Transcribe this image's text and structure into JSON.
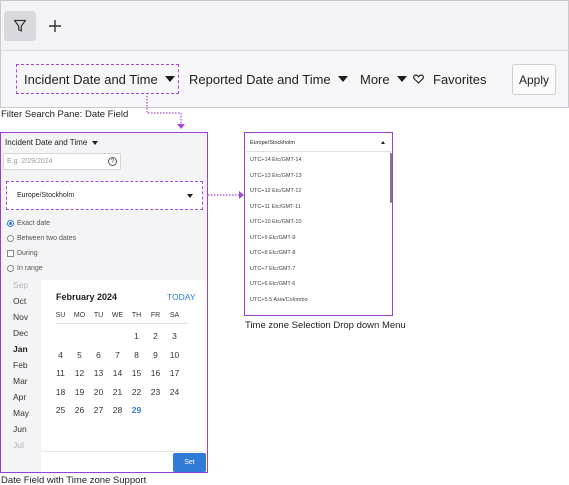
{
  "toolbar": {
    "filter_icon": "filter-funnel-icon",
    "add_icon": "plus-icon",
    "items": [
      {
        "label": "Incident Date and Time"
      },
      {
        "label": "Reported Date and Time"
      },
      {
        "label": "More"
      }
    ],
    "favorites_label": "Favorites",
    "favorites_icon": "heart-icon",
    "apply_label": "Apply"
  },
  "captions": {
    "filter_pane": "Filter Search Pane: Date Field",
    "tz_menu": "Time zone Selection Drop down Menu",
    "date_field": "Date Field with Time zone Support"
  },
  "panel": {
    "title": "Incident Date and Time",
    "placeholder": "E.g. 2/29/2024",
    "help_icon": "help-icon",
    "timezone": "Europe/Stockholm",
    "options": [
      {
        "label": "Exact date"
      },
      {
        "label": "Between two dates"
      },
      {
        "label": "During"
      },
      {
        "label": "In range"
      }
    ],
    "months": [
      "Sep",
      "Oct",
      "Nov",
      "Dec",
      "Jan",
      "Feb",
      "Mar",
      "Apr",
      "May",
      "Jun",
      "Jul"
    ],
    "calendar": {
      "title": "February 2024",
      "today_label": "TODAY",
      "weekdays": [
        "SU",
        "MO",
        "TU",
        "WE",
        "TH",
        "FR",
        "SA"
      ],
      "days": [
        "1",
        "2",
        "3",
        "4",
        "5",
        "6",
        "7",
        "8",
        "9",
        "10",
        "11",
        "12",
        "13",
        "14",
        "15",
        "16",
        "17",
        "18",
        "19",
        "20",
        "21",
        "22",
        "23",
        "24",
        "25",
        "26",
        "27",
        "28",
        "29"
      ],
      "highlight": "29"
    },
    "set_label": "Set"
  },
  "dropdown": {
    "selected": "Europe/Stockholm",
    "items": [
      "UTC+14 Etc/GMT-14",
      "UTC+13 Etc/GMT-13",
      "UTC+12 Etc/GMT-12",
      "UTC+11 Etc/GMT-11",
      "UTC+10 Etc/GMT-10",
      "UTC+9 Etc/GMT-9",
      "UTC+8 Etc/GMT-8",
      "UTC+7 Etc/GMT-7",
      "UTC+6 Etc/GMT-6",
      "UTC+5.5 Asia/Colombo"
    ]
  },
  "colors": {
    "accent": "#2f7bd6",
    "annotation": "#a548d6"
  }
}
